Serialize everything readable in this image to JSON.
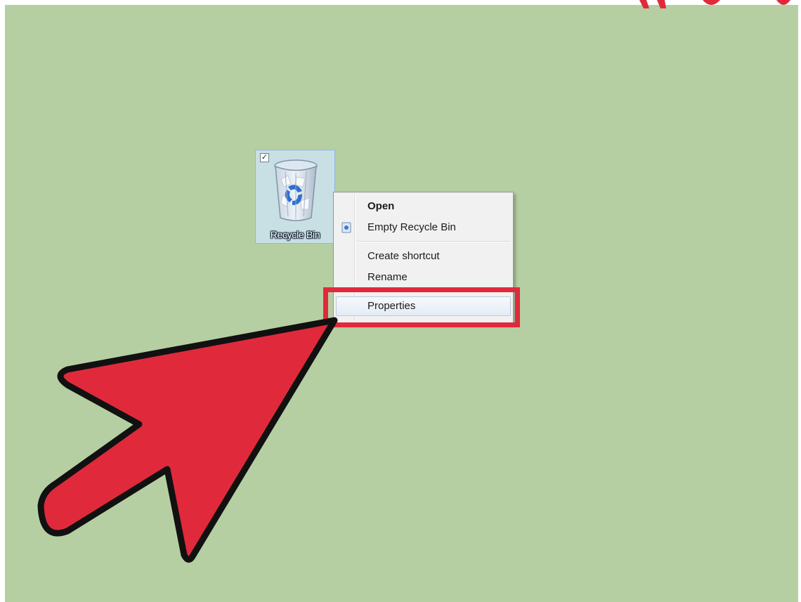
{
  "desktop": {
    "background_color": "#b6cfa2",
    "icons": [
      {
        "label": "Recycle Bin",
        "icon": "recycle-bin-icon",
        "selected": true,
        "checked": true
      }
    ]
  },
  "context_menu": {
    "items": [
      {
        "label": "Open",
        "bold": true
      },
      {
        "label": "Empty Recycle Bin",
        "icon": "recycle-bin-small-icon"
      },
      {
        "label": "Create shortcut"
      },
      {
        "label": "Rename"
      },
      {
        "label": "Properties",
        "highlighted": true
      }
    ]
  },
  "annotation": {
    "arrow_color": "#e02a3c",
    "highlight_color": "#e02a3c",
    "highlighted_item": "Properties"
  }
}
